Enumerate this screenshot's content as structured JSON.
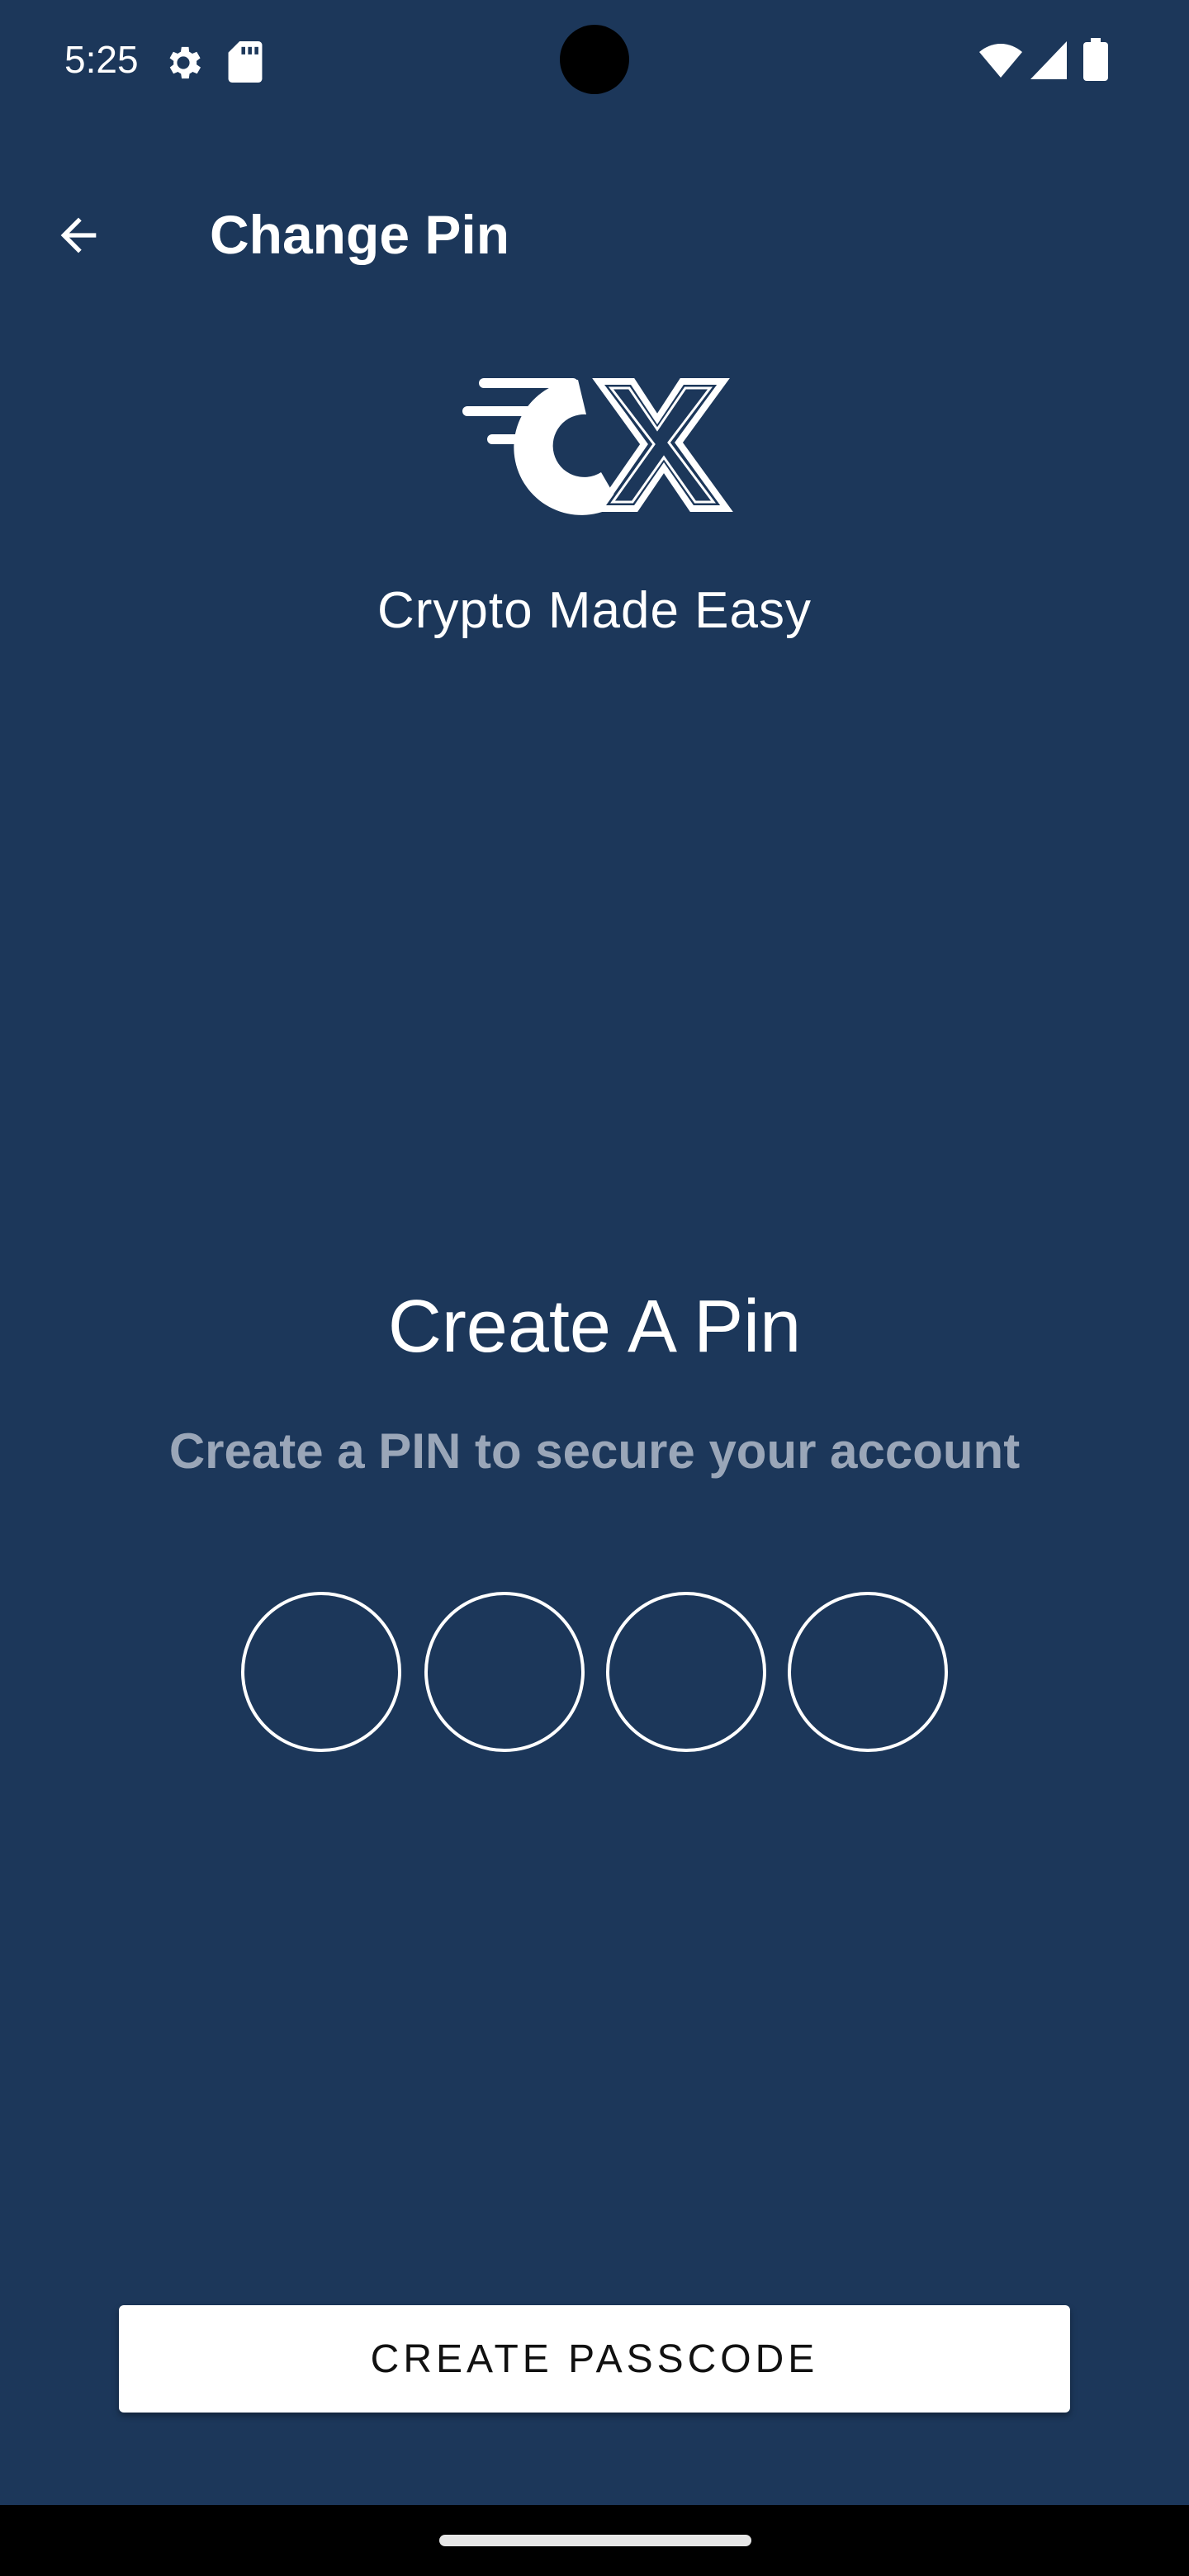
{
  "status_bar": {
    "time": "5:25",
    "icons": [
      "settings-gear-icon",
      "sd-card-icon",
      "wifi-icon",
      "cell-signal-icon",
      "battery-icon"
    ]
  },
  "app_bar": {
    "title": "Change Pin",
    "back_icon": "arrow-left-icon"
  },
  "brand": {
    "logo_icon": "cx-logo-icon",
    "tagline": "Crypto Made Easy"
  },
  "pin": {
    "heading": "Create A Pin",
    "subheading": "Create a PIN to secure your account",
    "digits": [
      "",
      "",
      "",
      ""
    ]
  },
  "actions": {
    "create_label": "CREATE PASSCODE"
  },
  "colors": {
    "background": "#1c375a",
    "text_primary": "#ffffff",
    "text_muted": "#9aa6b8",
    "button_bg": "#ffffff",
    "button_text": "#111111"
  }
}
